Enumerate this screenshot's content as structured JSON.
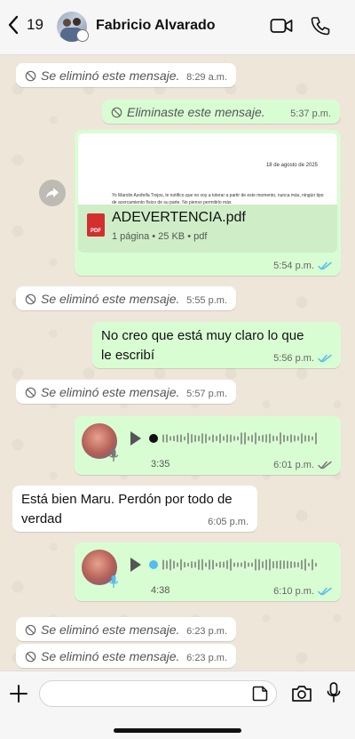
{
  "header": {
    "back_count": "19",
    "contact_name": "Fabricio Alvarado"
  },
  "messages": {
    "m1": {
      "text": "Se eliminó este mensaje.",
      "time": "8:29 a.m."
    },
    "m2": {
      "text": "Eliminaste este mensaje.",
      "time": "5:37 p.m."
    },
    "doc": {
      "preview_date": "18 de agosto de 2025",
      "preview_text": "Yo Marolin Azofeifa Trejos, le notifico que no voy a tolerar a partir de este momento, nunca más, ningún tipo de acercamiento físico de su parte. No pienso permitirlo más",
      "icon_label": "PDF",
      "file_name": "ADEVERTENCIA.pdf",
      "meta": "1 página • 25 KB • pdf",
      "time": "5:54 p.m."
    },
    "m4": {
      "text": "Se eliminó este mensaje.",
      "time": "5:55 p.m."
    },
    "m5": {
      "text": "No creo que está muy claro lo que le escribí",
      "time": "5:56 p.m."
    },
    "m6": {
      "text": "Se eliminó este mensaje.",
      "time": "5:57 p.m."
    },
    "voice1": {
      "duration": "3:35",
      "time": "6:01 p.m.",
      "progress": 0.0
    },
    "m8": {
      "text": "Está bien Maru. Perdón por todo de verdad",
      "time": "6:05 p.m."
    },
    "voice2": {
      "duration": "4:38",
      "time": "6:10 p.m.",
      "progress": 0.0
    },
    "m10": {
      "text": "Se eliminó este mensaje.",
      "time": "6:23 p.m."
    },
    "m11": {
      "text": "Se eliminó este mensaje.",
      "time": "6:23 p.m."
    }
  },
  "colors": {
    "outgoing_bubble": "#d9fdd3",
    "incoming_bubble": "#ffffff",
    "read_tick": "#53bdeb",
    "played_dot": "#53bdeb"
  },
  "icons": {
    "back": "chevron-left-icon",
    "video": "video-camera-icon",
    "phone": "phone-icon",
    "deleted": "ban-icon",
    "forward": "forward-icon",
    "play": "play-icon",
    "mic": "mic-icon",
    "plus": "plus-icon",
    "sticker": "sticker-icon",
    "camera": "camera-icon"
  }
}
